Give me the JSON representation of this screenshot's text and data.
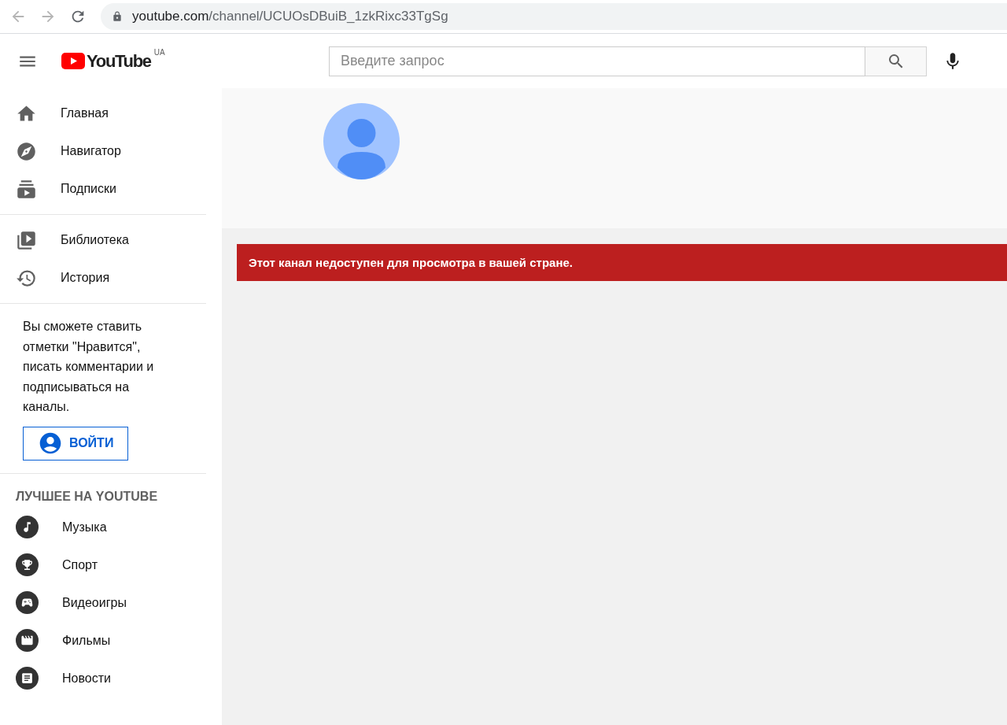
{
  "browser": {
    "url_host": "youtube.com",
    "url_path": "/channel/UCUOsDBuiB_1zkRixc33TgSg"
  },
  "header": {
    "logo": "YouTube",
    "region": "UA",
    "search": {
      "placeholder": "Введите запрос"
    }
  },
  "sidebar": {
    "sections": [
      {
        "items": [
          {
            "label": "Главная",
            "selected": false
          },
          {
            "label": "Навигатор",
            "selected": false
          },
          {
            "label": "Подписки",
            "selected": false
          }
        ]
      },
      {
        "items": [
          {
            "label": "Библиотека",
            "selected": false
          },
          {
            "label": "История",
            "selected": false
          }
        ]
      }
    ],
    "signin_prompt": "Вы сможете ставить отметки \"Нравится\", писать комментарии и подписываться на каналы.",
    "signin_button": "ВОЙТИ",
    "best_heading": "ЛУЧШЕЕ НА YOUTUBE",
    "best_items": [
      {
        "label": "Музыка"
      },
      {
        "label": "Спорт"
      },
      {
        "label": "Видеоигры"
      },
      {
        "label": "Фильмы"
      },
      {
        "label": "Новости"
      }
    ]
  },
  "channel": {
    "error": "Этот канал недоступен для просмотра в вашей стране."
  }
}
